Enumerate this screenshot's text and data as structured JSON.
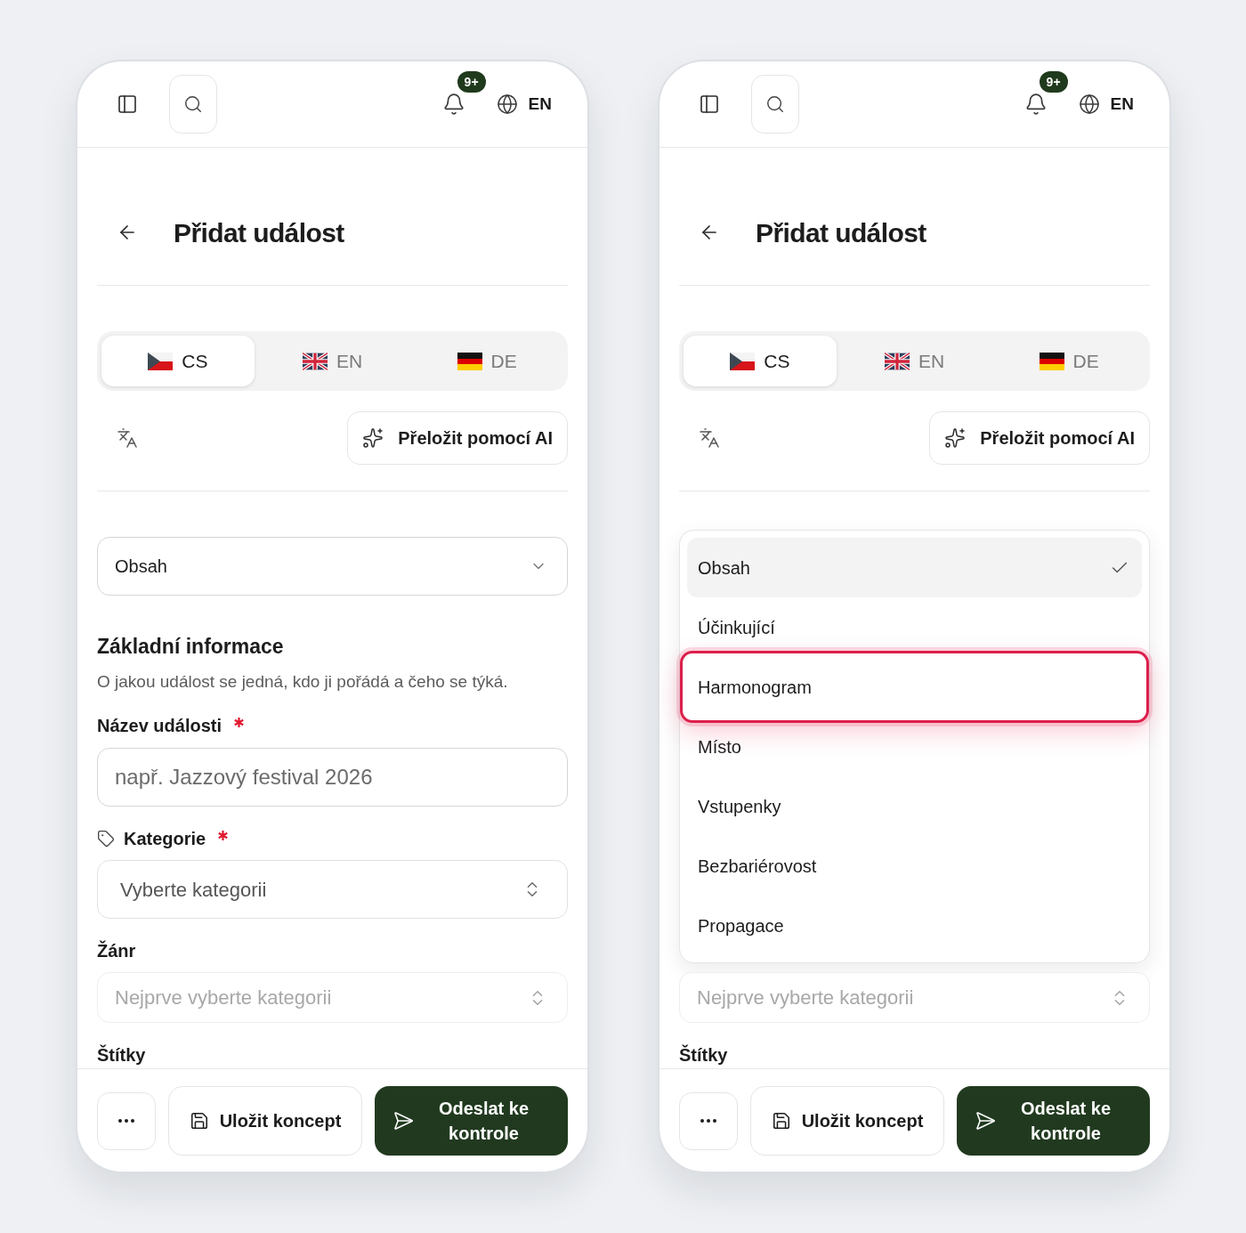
{
  "phones": [
    {
      "header": {
        "badge": "9+",
        "language": "EN"
      },
      "title": "Přidat událost",
      "language_tabs": [
        {
          "label": "CS",
          "selected": true
        },
        {
          "label": "EN",
          "selected": false
        },
        {
          "label": "DE",
          "selected": false
        }
      ],
      "translate_button": "Přeložit pomocí AI",
      "blocks": [
        {
          "kind": "select",
          "value": "Obsah"
        },
        {
          "kind": "section",
          "title": "Základní informace",
          "description": "O jakou událost se jedná, kdo ji pořádá a čeho se týká."
        },
        {
          "kind": "text_field",
          "label": "Název události",
          "required": true,
          "placeholder": "např. Jazzový festival 2026"
        },
        {
          "kind": "picker",
          "label": "Kategorie",
          "icon": true,
          "required": true,
          "placeholder": "Vyberte kategorii",
          "disabled": false
        },
        {
          "kind": "picker",
          "label": "Žánr",
          "placeholder": "Nejprve vyberte kategorii",
          "disabled": true
        },
        {
          "kind": "label",
          "label": "Štítky"
        }
      ],
      "footer": {
        "save_button": "Uložit koncept",
        "submit_button": "Odeslat ke kontrole"
      }
    },
    {
      "header": {
        "badge": "9+",
        "language": "EN"
      },
      "title": "Přidat událost",
      "language_tabs": [
        {
          "label": "CS",
          "selected": true
        },
        {
          "label": "EN",
          "selected": false
        },
        {
          "label": "DE",
          "selected": false
        }
      ],
      "translate_button": "Přeložit pomocí AI",
      "blocks": [
        {
          "kind": "menu",
          "options": [
            {
              "label": "Obsah",
              "selected": true,
              "focused": false
            },
            {
              "label": "Účinkující",
              "selected": false,
              "focused": false
            },
            {
              "label": "Harmonogram",
              "selected": false,
              "focused": true
            },
            {
              "label": "Místo",
              "selected": false,
              "focused": false
            },
            {
              "label": "Vstupenky",
              "selected": false,
              "focused": false
            },
            {
              "label": "Bezbariérovost",
              "selected": false,
              "focused": false
            },
            {
              "label": "Propagace",
              "selected": false,
              "focused": false
            }
          ]
        },
        {
          "kind": "picker",
          "placeholder": "Nejprve vyberte kategorii",
          "disabled": true
        },
        {
          "kind": "label",
          "label": "Štítky"
        }
      ],
      "footer": {
        "save_button": "Uložit koncept",
        "submit_button": "Odeslat ke kontrole"
      }
    }
  ]
}
